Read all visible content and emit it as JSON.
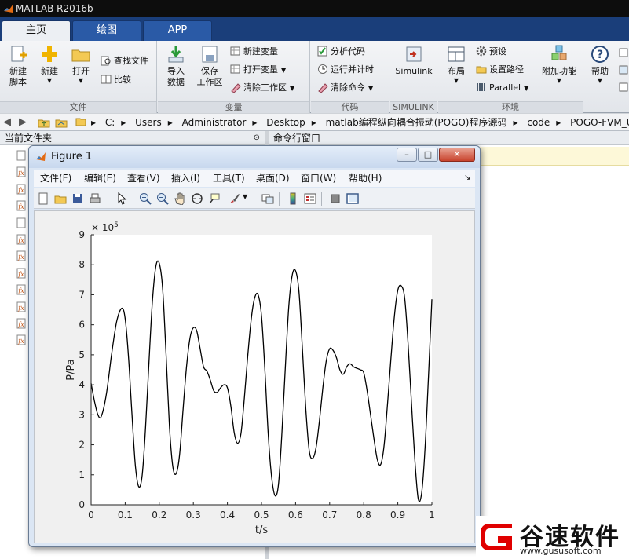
{
  "app": {
    "title": "MATLAB R2016b"
  },
  "tabs": [
    {
      "label": "主页",
      "active": true
    },
    {
      "label": "绘图",
      "active": false
    },
    {
      "label": "APP",
      "active": false
    }
  ],
  "ribbon": {
    "file": {
      "label": "文件",
      "new_script": "新建\n脚本",
      "new": "新建",
      "open": "打开",
      "find_files": "查找文件",
      "compare": "比较"
    },
    "variable": {
      "label": "变量",
      "import_data": "导入\n数据",
      "save_workspace": "保存\n工作区",
      "new_variable": "新建变量",
      "open_variable": "打开变量",
      "clear_workspace": "清除工作区"
    },
    "code": {
      "label": "代码",
      "analyze_code": "分析代码",
      "run_and_time": "运行并计时",
      "clear_commands": "清除命令"
    },
    "simulink": {
      "label": "SIMULINK",
      "button": "Simulink"
    },
    "environment": {
      "label": "环境",
      "layout": "布局",
      "preferences": "预设",
      "set_path": "设置路径",
      "parallel": "Parallel",
      "addons": "附加功能"
    },
    "resources": {
      "help": "帮助"
    }
  },
  "address": {
    "path": [
      "C:",
      "Users",
      "Administrator",
      "Desktop",
      "matlab编程纵向耦合振动(POGO)程序源码",
      "code",
      "POGO-FVM_Up"
    ]
  },
  "panels": {
    "current_folder": "当前文件夹",
    "command_window": "命令行窗口"
  },
  "figure": {
    "title": "Figure 1",
    "menus": [
      "文件(F)",
      "编辑(E)",
      "查看(V)",
      "插入(I)",
      "工具(T)",
      "桌面(D)",
      "窗口(W)",
      "帮助(H)"
    ],
    "buttons": {
      "minimize": "–",
      "maximize": "□",
      "close": "✕"
    }
  },
  "chart_data": {
    "type": "line",
    "xlabel": "t/s",
    "ylabel": "P/Pa",
    "y_exponent_base": "× 10",
    "y_exponent_power": "5",
    "xlim": [
      0,
      1
    ],
    "ylim": [
      0,
      9
    ],
    "xticks": [
      0,
      0.1,
      0.2,
      0.3,
      0.4,
      0.5,
      0.6,
      0.7,
      0.8,
      0.9,
      1
    ],
    "xtick_labels": [
      "0",
      "0.1",
      "0.2",
      "0.3",
      "0.4",
      "0.5",
      "0.6",
      "0.7",
      "0.8",
      "0.9",
      "1"
    ],
    "yticks": [
      0,
      1,
      2,
      3,
      4,
      5,
      6,
      7,
      8,
      9
    ],
    "ytick_labels": [
      "0",
      "1",
      "2",
      "3",
      "4",
      "5",
      "6",
      "7",
      "8",
      "9"
    ],
    "grid": false,
    "series": [
      {
        "color": "#000000",
        "x": [
          0,
          0.01,
          0.02,
          0.03,
          0.045,
          0.06,
          0.075,
          0.09,
          0.1,
          0.11,
          0.12,
          0.13,
          0.14,
          0.15,
          0.16,
          0.17,
          0.18,
          0.19,
          0.2,
          0.21,
          0.22,
          0.23,
          0.24,
          0.25,
          0.26,
          0.27,
          0.28,
          0.29,
          0.3,
          0.31,
          0.32,
          0.33,
          0.34,
          0.35,
          0.36,
          0.37,
          0.38,
          0.39,
          0.4,
          0.41,
          0.42,
          0.43,
          0.44,
          0.45,
          0.46,
          0.47,
          0.48,
          0.49,
          0.5,
          0.51,
          0.52,
          0.53,
          0.54,
          0.55,
          0.56,
          0.57,
          0.58,
          0.59,
          0.6,
          0.61,
          0.62,
          0.63,
          0.64,
          0.65,
          0.66,
          0.67,
          0.68,
          0.69,
          0.7,
          0.71,
          0.72,
          0.73,
          0.74,
          0.75,
          0.76,
          0.77,
          0.78,
          0.79,
          0.8,
          0.81,
          0.82,
          0.83,
          0.84,
          0.85,
          0.86,
          0.87,
          0.88,
          0.89,
          0.9,
          0.91,
          0.92,
          0.93,
          0.94,
          0.95,
          0.96,
          0.97,
          0.98,
          0.99,
          1.0
        ],
        "y": [
          4.05,
          3.45,
          3.0,
          2.95,
          3.7,
          5.0,
          6.1,
          6.55,
          6.2,
          4.9,
          3.0,
          1.3,
          0.6,
          1.0,
          2.6,
          4.8,
          6.8,
          7.95,
          8.05,
          7.2,
          5.0,
          2.6,
          1.25,
          1.05,
          1.7,
          3.2,
          4.6,
          5.55,
          5.9,
          5.8,
          5.2,
          4.6,
          4.45,
          4.15,
          3.8,
          3.75,
          3.9,
          4.0,
          3.9,
          3.3,
          2.4,
          2.05,
          2.4,
          3.6,
          5.0,
          6.2,
          6.9,
          7.0,
          6.3,
          4.5,
          2.3,
          0.9,
          0.3,
          0.7,
          2.4,
          4.6,
          6.6,
          7.65,
          7.8,
          7.1,
          5.2,
          3.2,
          1.8,
          1.55,
          1.9,
          2.8,
          3.9,
          4.8,
          5.2,
          5.15,
          4.9,
          4.5,
          4.35,
          4.6,
          4.7,
          4.6,
          4.55,
          4.5,
          4.4,
          3.8,
          3.0,
          2.2,
          1.5,
          1.35,
          2.0,
          3.4,
          4.9,
          6.3,
          7.15,
          7.3,
          6.9,
          5.4,
          3.4,
          1.5,
          0.2,
          0.4,
          1.9,
          4.3,
          6.85
        ]
      }
    ]
  },
  "watermark": {
    "brand": "谷速软件",
    "url": "www.gususoft.com"
  }
}
